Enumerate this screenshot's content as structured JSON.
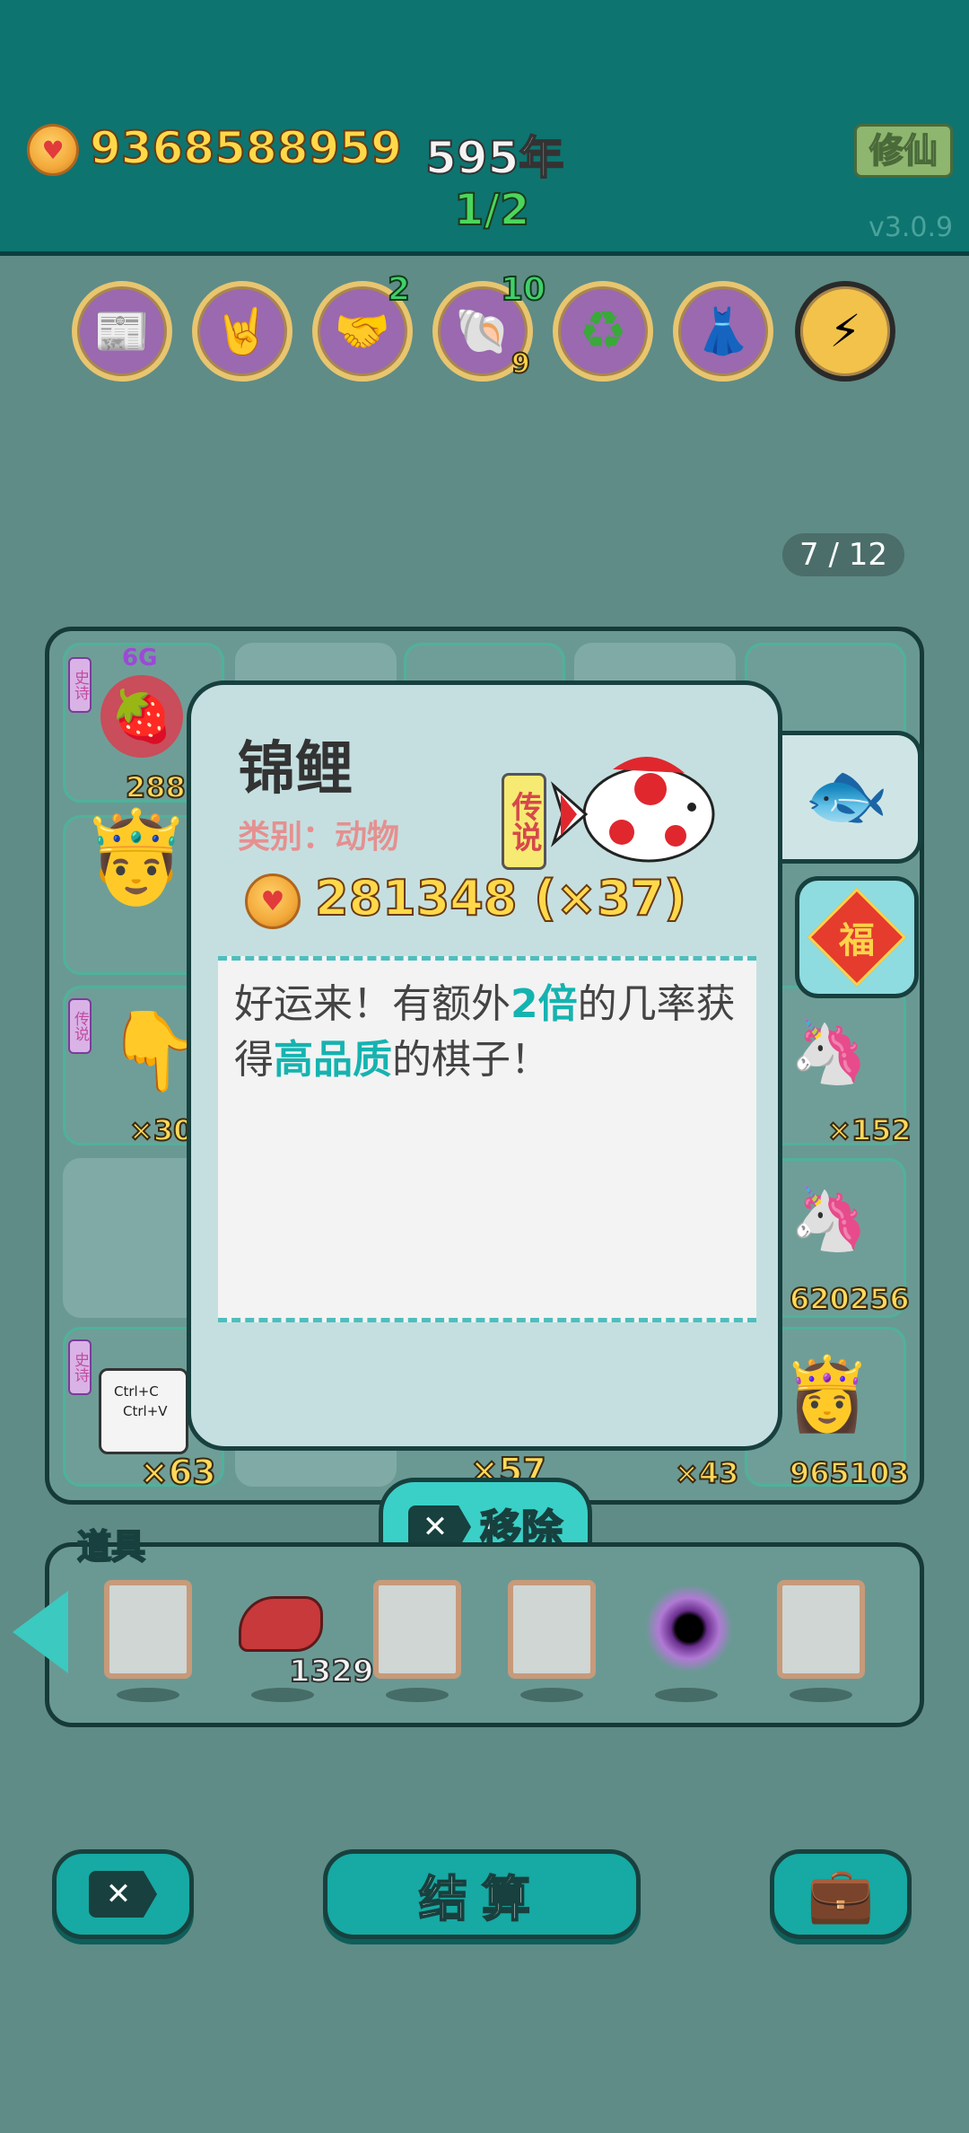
{
  "header": {
    "coins": "9368588959",
    "year": "595年",
    "progress": "1/2",
    "cultivate_label": "修仙",
    "version": "v3.0.9"
  },
  "toolbar": {
    "items": [
      {
        "name": "time-magazine",
        "icon": "📰",
        "badge": ""
      },
      {
        "name": "rock-hand",
        "icon": "🤘",
        "badge": ""
      },
      {
        "name": "handshake",
        "icon": "🤝",
        "badge": "2"
      },
      {
        "name": "shell",
        "icon": "🐚",
        "badge": "10",
        "badge2": "9"
      },
      {
        "name": "recycle",
        "icon": "♻",
        "badge": ""
      },
      {
        "name": "skirt",
        "icon": "👗",
        "badge": ""
      },
      {
        "name": "lightning",
        "icon": "⚡",
        "badge": ""
      }
    ]
  },
  "pagination": "7 / 12",
  "board": {
    "badges": {
      "sixg": "6G"
    },
    "tags": {
      "epic": "史诗",
      "legend": "传说"
    },
    "counts": {
      "r1c1": "288",
      "r3c1": "×30",
      "r3c5": "×152",
      "r4c5": "620256",
      "r5c1": "×63",
      "r5c3": "×57",
      "r5c4": "×43",
      "r5c5": "965103"
    },
    "ctrl_card": {
      "line1": "Ctrl+C",
      "line2": "Ctrl+V"
    }
  },
  "modal": {
    "title": "锦鲤",
    "category": "类别：动物",
    "rarity": "传说",
    "price": "281348 (×37)",
    "desc": {
      "p1": "好运来！有额外",
      "h1": "2倍",
      "p2": "的几率获得",
      "h2": "高品质",
      "p3": "的棋子！"
    },
    "fu": "福"
  },
  "remove_button": "移除",
  "items_bar": {
    "label": "道具",
    "liver_count": "1329"
  },
  "bottom": {
    "settle_label": "结算"
  },
  "colors": {
    "background": "#5f8c86",
    "header": "#0e7470",
    "accent": "#15b3b0",
    "coin_text": "#ffd94a"
  }
}
